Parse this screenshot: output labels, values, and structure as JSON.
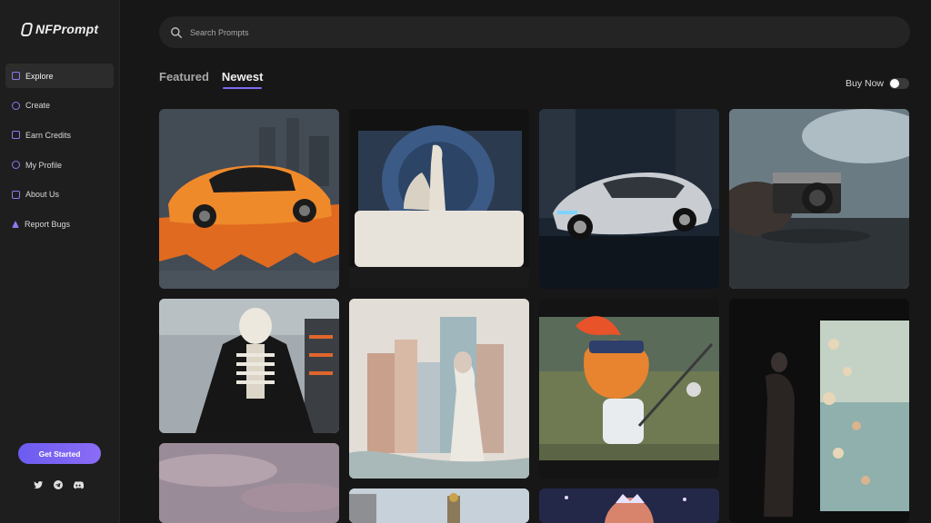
{
  "app": {
    "logo_text": "NFPrompt"
  },
  "sidebar": {
    "items": [
      {
        "label": "Explore",
        "icon": "compass-icon",
        "active": true
      },
      {
        "label": "Create",
        "icon": "shield-icon"
      },
      {
        "label": "Earn Credits",
        "icon": "home-icon"
      },
      {
        "label": "My Profile",
        "icon": "user-icon"
      },
      {
        "label": "About Us",
        "icon": "info-icon"
      },
      {
        "label": "Report Bugs",
        "icon": "warning-icon"
      }
    ],
    "cta_label": "Get Started",
    "socials": [
      "twitter-icon",
      "telegram-icon",
      "discord-icon"
    ]
  },
  "search": {
    "placeholder": "Search Prompts",
    "value": ""
  },
  "tabs": [
    {
      "label": "Featured",
      "active": false
    },
    {
      "label": "Newest",
      "active": true
    }
  ],
  "filters": {
    "buy_now_label": "Buy Now",
    "buy_now_on": false
  },
  "accent_color": "#7c6cf2",
  "gallery": [
    "orange-sports-car",
    "bedroom-silhouettes",
    "silver-concept-car",
    "vintage-camera-puddle",
    "skeleton-cape",
    "watercolor-city-woman",
    "cartoon-fox-fencer",
    "woman-window-flowers",
    "pink-sky",
    "cathedral-tower",
    "anime-girl-tiara"
  ]
}
